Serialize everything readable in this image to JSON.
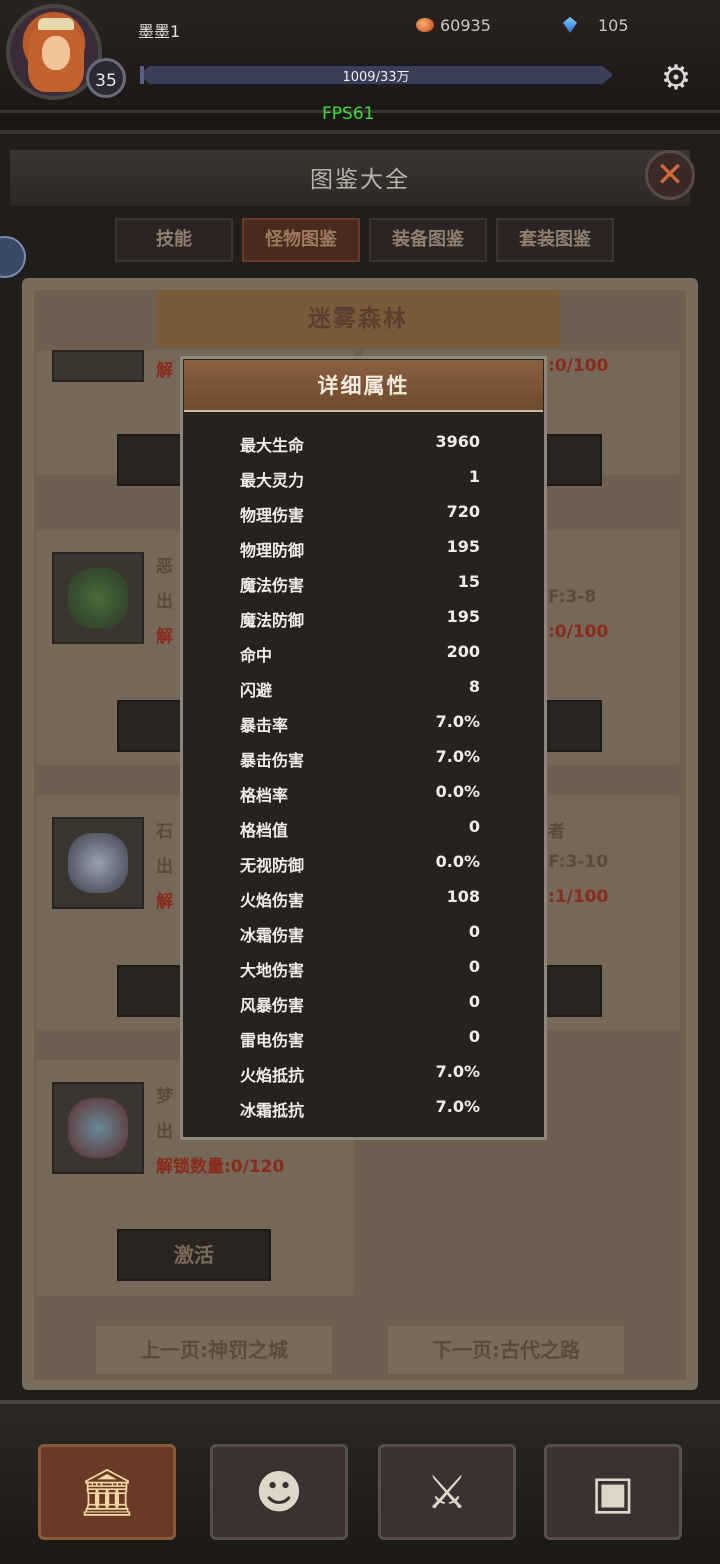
{
  "top": {
    "player_name": "墨墨1",
    "level": "35",
    "gold": "60935",
    "gems": "105",
    "exp_text": "1009/33万",
    "exp_fraction": 0.003,
    "fps": "FPS61"
  },
  "panel": {
    "title": "图鉴大全",
    "tabs": [
      {
        "label": "技能"
      },
      {
        "label": "怪物图鉴"
      },
      {
        "label": "装备图鉴"
      },
      {
        "label": "套装图鉴"
      }
    ],
    "region": "迷雾森林"
  },
  "cards": {
    "c1_req": "解",
    "c1_right_req": ":0/100",
    "activate": "激活",
    "c2_name": "恶",
    "c2_out": "出",
    "c2_req": "解",
    "c2_right_name": "",
    "c2_right_lv": "F:3-8",
    "c2_right_req": ":0/100",
    "c3_name": "石",
    "c3_out": "出",
    "c3_req": "解",
    "c3_right_name": "者",
    "c3_right_lv": "F:3-10",
    "c3_right_req": ":1/100",
    "c4_name": "梦",
    "c4_out": "出",
    "c4_req": "解锁数量:0/120"
  },
  "pager": {
    "prev": "上一页:神罚之城",
    "next": "下一页:古代之路"
  },
  "popup": {
    "title": "详细属性",
    "stats": [
      {
        "k": "最大生命",
        "v": "3960"
      },
      {
        "k": "最大灵力",
        "v": "1"
      },
      {
        "k": "物理伤害",
        "v": "720"
      },
      {
        "k": "物理防御",
        "v": "195"
      },
      {
        "k": "魔法伤害",
        "v": "15"
      },
      {
        "k": "魔法防御",
        "v": "195"
      },
      {
        "k": "命中",
        "v": "200"
      },
      {
        "k": "闪避",
        "v": "8"
      },
      {
        "k": "暴击率",
        "v": "7.0%"
      },
      {
        "k": "暴击伤害",
        "v": "7.0%"
      },
      {
        "k": "格档率",
        "v": "0.0%"
      },
      {
        "k": "格档值",
        "v": "0"
      },
      {
        "k": "无视防御",
        "v": "0.0%"
      },
      {
        "k": "火焰伤害",
        "v": "108"
      },
      {
        "k": "冰霜伤害",
        "v": "0"
      },
      {
        "k": "大地伤害",
        "v": "0"
      },
      {
        "k": "风暴伤害",
        "v": "0"
      },
      {
        "k": "雷电伤害",
        "v": "0"
      },
      {
        "k": "火焰抵抗",
        "v": "7.0%"
      },
      {
        "k": "冰霜抵抗",
        "v": "7.0%"
      }
    ]
  },
  "nav": {
    "items": [
      {
        "icon": "museum-icon",
        "glyph": "🏛"
      },
      {
        "icon": "character-icon",
        "glyph": "☻"
      },
      {
        "icon": "crossed-swords-icon",
        "glyph": "⚔"
      },
      {
        "icon": "treasure-chest-icon",
        "glyph": "▣"
      }
    ]
  }
}
